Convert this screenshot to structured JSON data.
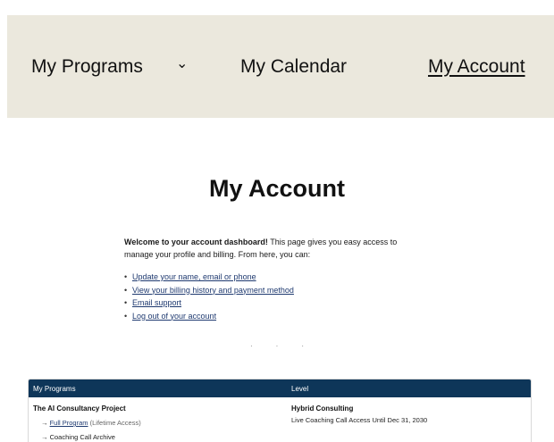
{
  "nav": {
    "programs_label": "My Programs",
    "programs_chevron": "⌄",
    "calendar_label": "My Calendar",
    "account_label": "My Account"
  },
  "page": {
    "title": "My Account",
    "intro_bold": "Welcome to your account dashboard!",
    "intro_text": " This page gives you easy access to manage your profile and billing. From here, you can:",
    "links": [
      "Update your name, email or phone",
      "View your billing history and payment method",
      "Email support",
      "Log out of your account"
    ],
    "divider": "···"
  },
  "table": {
    "headers": [
      "My Programs",
      "Level"
    ],
    "rows": [
      {
        "program": "The AI Consultancy Project",
        "sub_items": [
          {
            "arrow": "→",
            "link": "Full Program",
            "note": "(Lifetime Access)"
          },
          {
            "arrow": "→",
            "link": "",
            "note": "Coaching Call Archive"
          }
        ],
        "level": "Hybrid Consulting",
        "level_detail": "Live Coaching Call Access Until Dec 31, 2030"
      }
    ]
  },
  "colors": {
    "nav_bg": "#ebe8dd",
    "table_header_bg": "#0e3659",
    "link": "#1f3a70"
  }
}
